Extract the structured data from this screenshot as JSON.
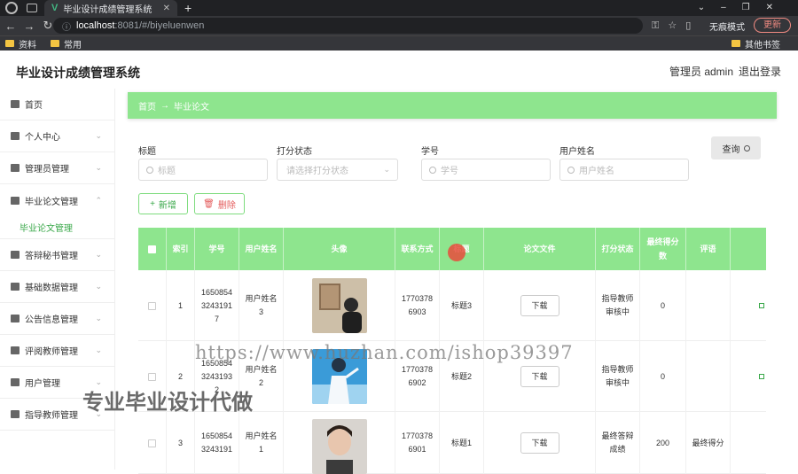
{
  "browser": {
    "tab_title": "毕业设计成绩管理系统",
    "url_host": "localhost",
    "url_path": ":8081/#/biyeluenwen",
    "incognito": "无痕模式",
    "update_label": "更新",
    "bookmarks": [
      "资料",
      "常用"
    ],
    "other_bookmarks": "其他书签"
  },
  "header": {
    "title": "毕业设计成绩管理系统",
    "user": "管理员 admin",
    "logout": "退出登录"
  },
  "sidebar": {
    "items": [
      {
        "label": "首页",
        "icon": "home-icon"
      },
      {
        "label": "个人中心",
        "icon": "user-icon"
      },
      {
        "label": "管理员管理",
        "icon": "sliders-icon"
      },
      {
        "label": "毕业论文管理",
        "icon": "mail-icon",
        "expanded": true
      },
      {
        "label": "答辩秘书管理",
        "icon": "clipboard-icon"
      },
      {
        "label": "基础数据管理",
        "icon": "chat-icon"
      },
      {
        "label": "公告信息管理",
        "icon": "doc-icon"
      },
      {
        "label": "评阅教师管理",
        "icon": "comment-icon"
      },
      {
        "label": "用户管理",
        "icon": "building-icon"
      },
      {
        "label": "指导教师管理",
        "icon": "crop-icon"
      }
    ],
    "sub_item": "毕业论文管理"
  },
  "breadcrumb": {
    "home": "首页",
    "arrow": "→",
    "current": "毕业论文"
  },
  "filters": {
    "title_label": "标题",
    "title_placeholder": "标题",
    "status_label": "打分状态",
    "status_placeholder": "请选择打分状态",
    "student_label": "学号",
    "student_placeholder": "学号",
    "username_label": "用户姓名",
    "username_placeholder": "用户姓名",
    "query": "查询"
  },
  "actions": {
    "add": "新增",
    "delete": "删除"
  },
  "table": {
    "headers": [
      "索引",
      "学号",
      "用户姓名",
      "头像",
      "联系方式",
      "标题",
      "论文文件",
      "打分状态",
      "最终得分数",
      "评语"
    ],
    "download_label": "下载",
    "rows": [
      {
        "index": "1",
        "student_id": "1650854\n3243191\n7",
        "name": "用户姓名\n3",
        "phone": "1770378\n6903",
        "title": "标题3",
        "status": "指导教师\n审核中",
        "score": "0",
        "comment": ""
      },
      {
        "index": "2",
        "student_id": "1650854\n3243193\n2",
        "name": "用户姓名\n2",
        "phone": "1770378\n6902",
        "title": "标题2",
        "status": "指导教师\n审核中",
        "score": "0",
        "comment": ""
      },
      {
        "index": "3",
        "student_id": "1650854\n3243191",
        "name": "用户姓名\n1",
        "phone": "1770378\n6901",
        "title": "标题1",
        "status": "最终答辩\n成绩",
        "score": "200",
        "comment": "最终得分"
      }
    ]
  },
  "watermarks": {
    "url": "https://www.huzhan.com/ishop39397",
    "slogan": "专业毕业设计代做"
  },
  "colors": {
    "accent": "#8ee58e",
    "accent_text": "#3aa84a",
    "danger": "#e45b5b"
  }
}
